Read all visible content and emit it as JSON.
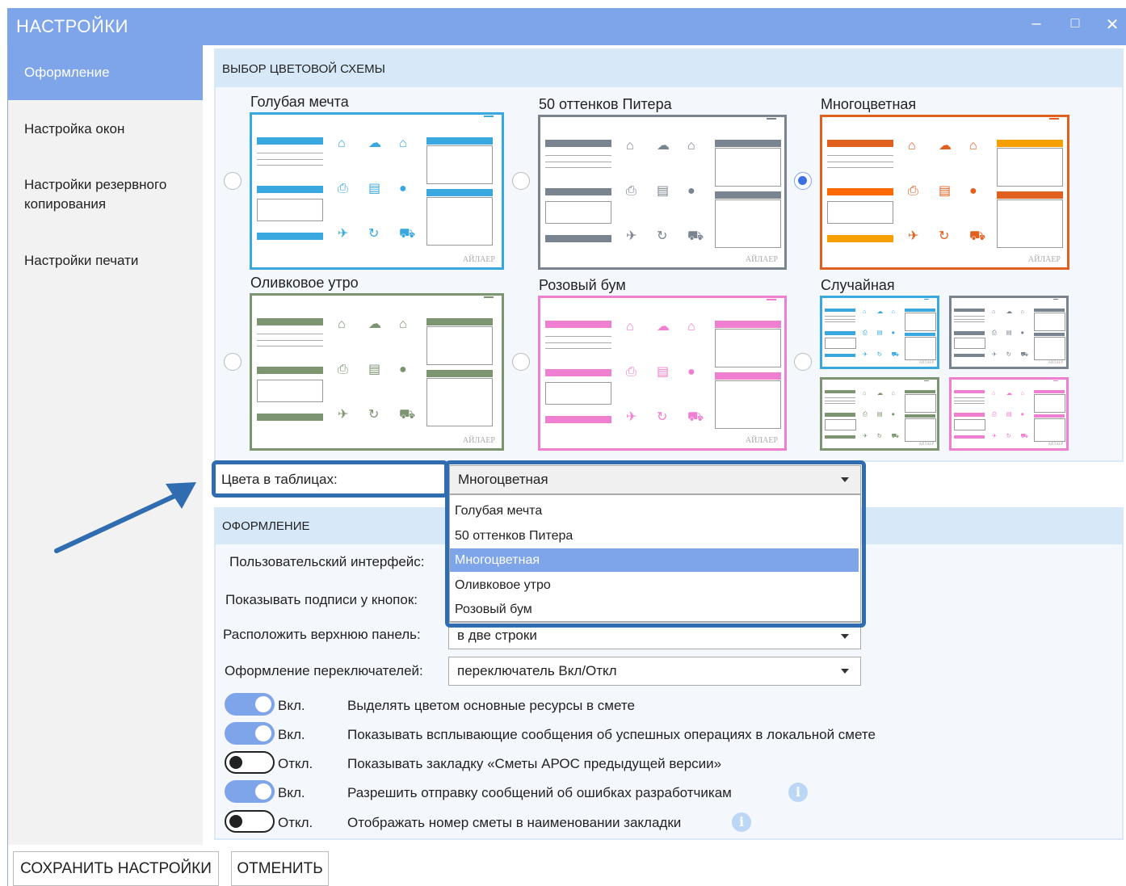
{
  "window": {
    "title": "НАСТРОЙКИ",
    "minimize": "‒",
    "maximize": "□",
    "close": "✕"
  },
  "sidebar": {
    "items": [
      {
        "label": "Оформление",
        "active": true
      },
      {
        "label": "Настройка окон"
      },
      {
        "label": "Настройки резервного копирования"
      },
      {
        "label": "Настройки печати"
      }
    ]
  },
  "schemes": {
    "header": "ВЫБОР ЦВЕТОВОЙ СХЕМЫ",
    "items": [
      {
        "name": "Голубая мечта",
        "color": "#3aa8e0"
      },
      {
        "name": "50 оттенков Питера",
        "color": "#7a8390"
      },
      {
        "name": "Многоцветная",
        "color": "#e06020",
        "selected": true
      },
      {
        "name": "Оливковое утро",
        "color": "#7d9470"
      },
      {
        "name": "Розовый бум",
        "color": "#ef7fd0"
      },
      {
        "name": "Случайная"
      }
    ],
    "watermark": "АЙЛАЕР"
  },
  "table_colors": {
    "label": "Цвета в таблицах:",
    "value": "Многоцветная",
    "options": [
      "Голубая мечта",
      "50 оттенков Питера",
      "Многоцветная",
      "Оливковое утро",
      "Розовый бум"
    ],
    "selected_index": 2
  },
  "appearance": {
    "header": "ОФОРМЛЕНИЕ",
    "ui_label": "Пользовательский интерфейс:",
    "captions_label": "Показывать подписи у кнопок:",
    "panel_label": "Расположить верхнюю панель:",
    "panel_value": "в две строки",
    "switch_label": "Оформление переключателей:",
    "switch_value": "переключатель Вкл/Откл"
  },
  "toggles": [
    {
      "state": "Вкл.",
      "on": true,
      "label": "Выделять цветом основные ресурсы в смете"
    },
    {
      "state": "Вкл.",
      "on": true,
      "label": "Показывать всплывающие сообщения об успешных операциях в локальной смете"
    },
    {
      "state": "Откл.",
      "on": false,
      "label": "Показывать закладку «Сметы АРОС предыдущей версии»"
    },
    {
      "state": "Вкл.",
      "on": true,
      "label": "Разрешить отправку сообщений об ошибках разработчикам",
      "info": "i"
    },
    {
      "state": "Откл.",
      "on": false,
      "label": "Отображать номер сметы в наименовании закладки",
      "info": "i"
    }
  ],
  "buttons": {
    "save": "СОХРАНИТЬ НАСТРОЙКИ",
    "cancel": "ОТМЕНИТЬ"
  },
  "icons": {
    "home": "⌂",
    "cloud": "☁",
    "print": "⎙",
    "archive": "▤",
    "info": "●",
    "pin": "✈",
    "refresh": "↻",
    "cart": "⛟"
  }
}
